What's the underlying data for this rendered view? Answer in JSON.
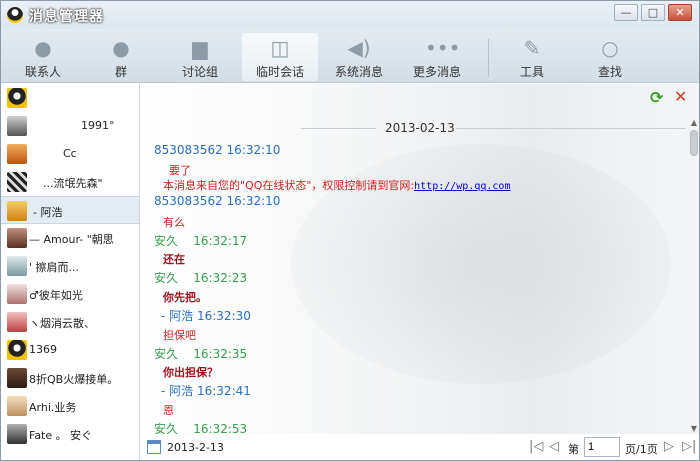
{
  "window": {
    "title": "消息管理器",
    "minimize": "—",
    "maximize": "□",
    "close": "✕"
  },
  "toolbar": {
    "items": [
      {
        "label": "联系人",
        "icon": "person-icon"
      },
      {
        "label": "群",
        "icon": "group-icon"
      },
      {
        "label": "讨论组",
        "icon": "discussion-icon"
      },
      {
        "label": "临时会话",
        "icon": "temp-chat-icon"
      },
      {
        "label": "系统消息",
        "icon": "speaker-icon"
      },
      {
        "label": "更多消息",
        "icon": "more-icon"
      },
      {
        "label": "工具",
        "icon": "wrench-icon"
      },
      {
        "label": "查找",
        "icon": "search-icon"
      }
    ]
  },
  "sidebar": {
    "items": [
      {
        "name": ""
      },
      {
        "name": "1991°"
      },
      {
        "name": "Cc"
      },
      {
        "name": "...流氓先森\""
      },
      {
        "name": "- 阿浩"
      },
      {
        "name": "— Amour- \"朝思"
      },
      {
        "name": "' 擦肩而..."
      },
      {
        "name": "♂彼年如光"
      },
      {
        "name": "ヽ烟消云散、"
      },
      {
        "name": "1369"
      },
      {
        "name": "8折QB火爆接单。"
      },
      {
        "name": "Arhi.业务"
      },
      {
        "name": "Fate 。 安ぐ"
      }
    ]
  },
  "chat": {
    "date": "2013-02-13",
    "messages": [
      {
        "sender": "853083562",
        "time": "16:32:10",
        "text": "要了"
      },
      {
        "sender": "",
        "time": "",
        "text": "本消息来自您的\"QQ在线状态\"，权限控制请到官网:",
        "link": "http://wp.qq.com"
      },
      {
        "sender": "853083562",
        "time": "16:32:10",
        "text": "有么"
      },
      {
        "sender": "安久",
        "time": "16:32:17",
        "text": "还在"
      },
      {
        "sender": "安久",
        "time": "16:32:23",
        "text": "你先把。"
      },
      {
        "sender": "- 阿浩",
        "time": "16:32:30",
        "text": "担保吧"
      },
      {
        "sender": "安久",
        "time": "16:32:35",
        "text": "你出担保？"
      },
      {
        "sender": "- 阿浩",
        "time": "16:32:41",
        "text": "恩"
      },
      {
        "sender": "安久",
        "time": "16:32:53",
        "text": ""
      }
    ]
  },
  "statusbar": {
    "date": "2013-2-13",
    "page_prefix": "第",
    "page_value": "1",
    "page_suffix": "页/1页"
  },
  "colors": {
    "self": "#3aa050",
    "other": "#2a6fc0",
    "system": "#d42020"
  }
}
